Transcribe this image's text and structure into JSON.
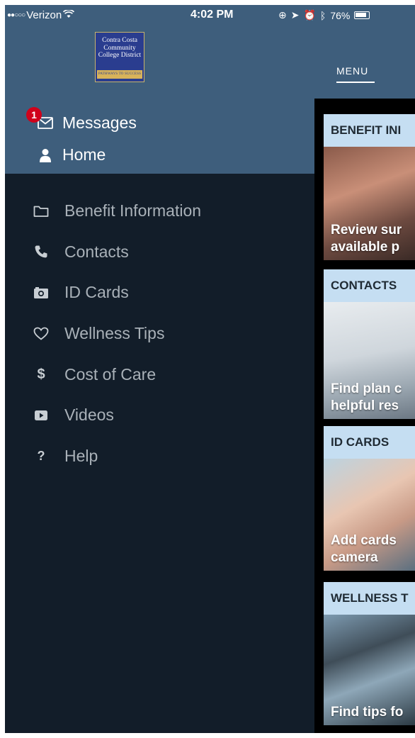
{
  "status_bar": {
    "carrier": "Verizon",
    "time": "4:02 PM",
    "battery": "76%"
  },
  "logo": {
    "line1": "Contra Costa",
    "line2": "Community",
    "line3": "College District",
    "tagline": "PATHWAYS TO SUCCESS"
  },
  "drawer": {
    "messages": {
      "label": "Messages",
      "badge": "1",
      "icon": "envelope-icon"
    },
    "home": {
      "label": "Home",
      "icon": "user-icon"
    },
    "items": [
      {
        "label": "Benefit Information",
        "icon": "folder-icon"
      },
      {
        "label": "Contacts",
        "icon": "phone-icon"
      },
      {
        "label": "ID Cards",
        "icon": "camera-icon"
      },
      {
        "label": "Wellness Tips",
        "icon": "heart-icon"
      },
      {
        "label": "Cost of Care",
        "icon": "dollar-icon"
      },
      {
        "label": "Videos",
        "icon": "video-icon"
      },
      {
        "label": "Help",
        "icon": "question-icon"
      }
    ]
  },
  "content": {
    "tab_label": "MENU",
    "cards": [
      {
        "title": "BENEFIT INI",
        "desc_line1": "Review sur",
        "desc_line2": "available p"
      },
      {
        "title": "CONTACTS",
        "desc_line1": "Find plan c",
        "desc_line2": "helpful res"
      },
      {
        "title": "ID CARDS",
        "desc_line1": "Add cards",
        "desc_line2": "camera"
      },
      {
        "title": "WELLNESS T",
        "desc_line1": "Find tips fo",
        "desc_line2": ""
      }
    ]
  },
  "colors": {
    "drawer_header": "#3e5e7c",
    "drawer_body": "#121d29",
    "card_title_bg": "#c5def2",
    "badge": "#d0021b"
  }
}
